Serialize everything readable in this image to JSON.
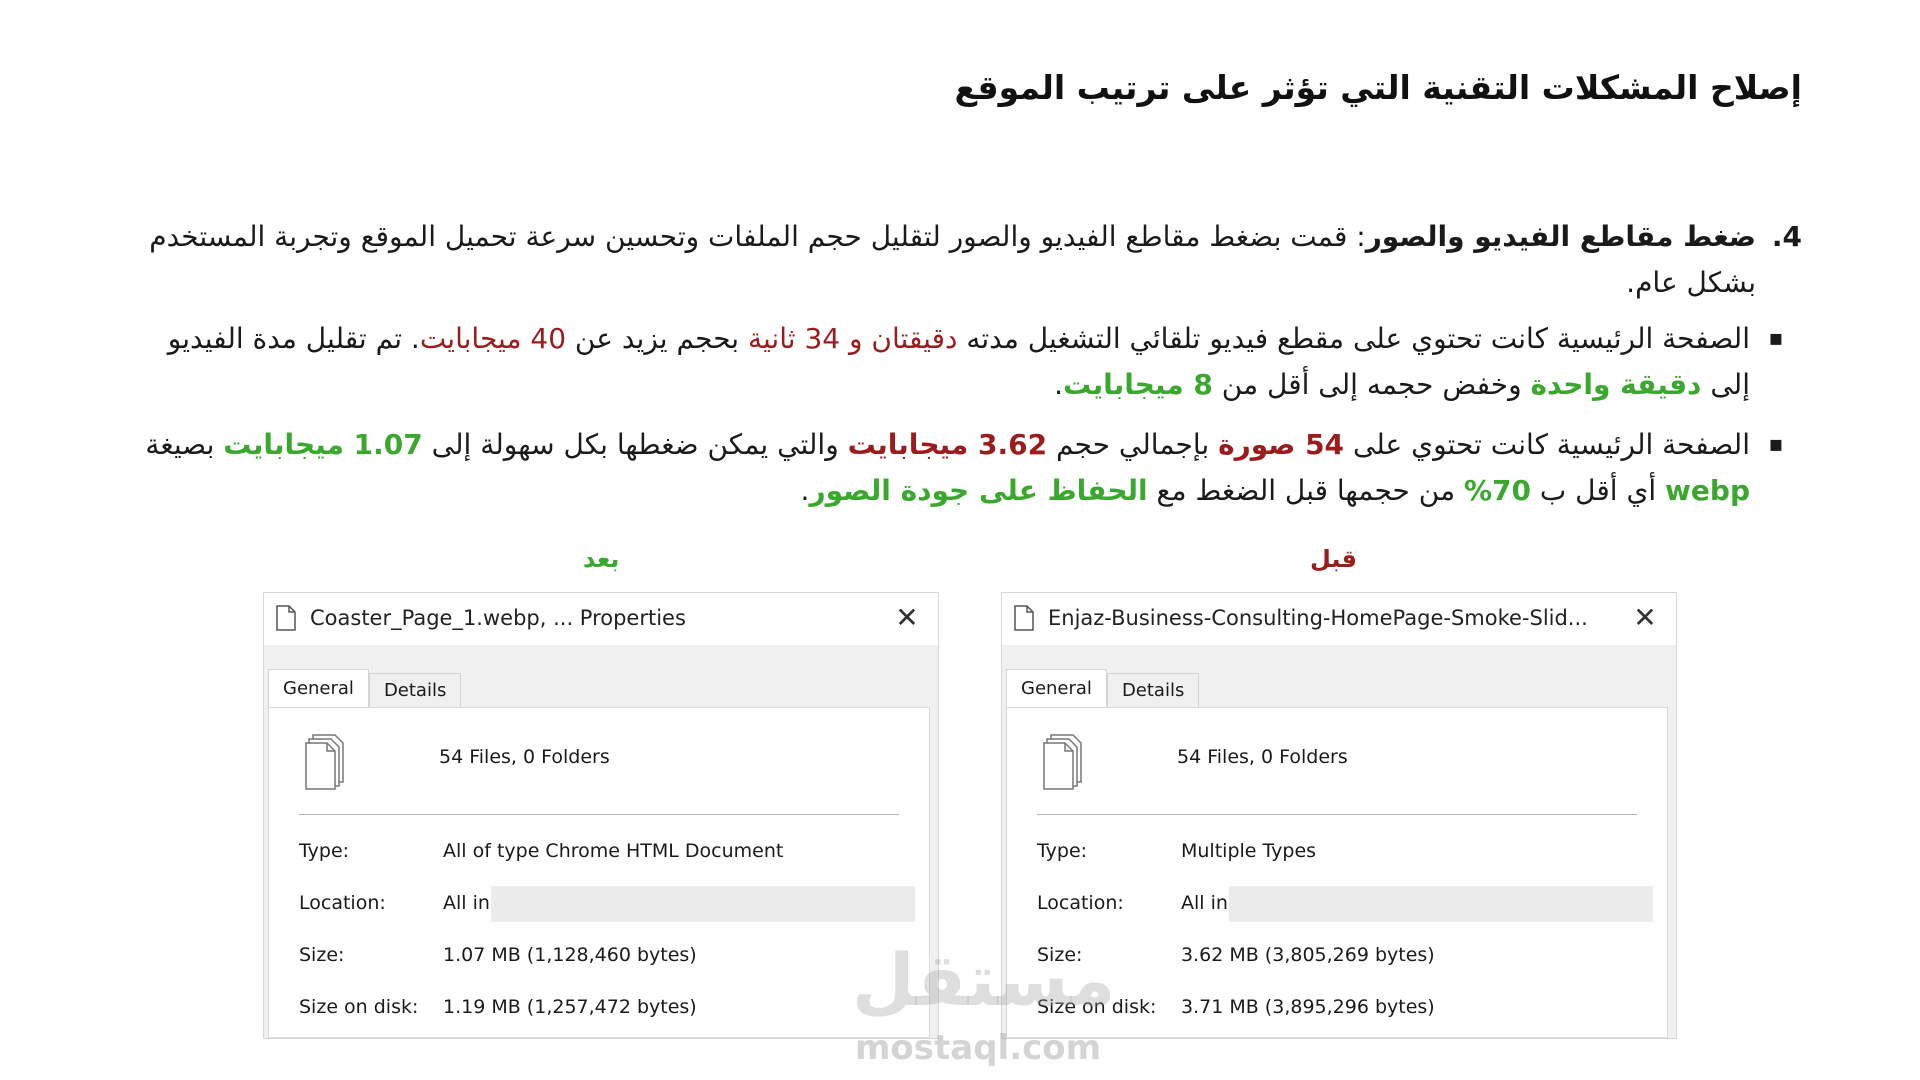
{
  "title": "إصلاح المشكلات التقنية التي تؤثر على ترتيب الموقع",
  "point": {
    "number": "4.",
    "heading": "ضغط مقاطع الفيديو والصور",
    "body": ": قمت بضغط مقاطع الفيديو والصور لتقليل حجم الملفات وتحسين سرعة تحميل الموقع وتجربة المستخدم بشكل عام."
  },
  "bullet1": {
    "t1": "الصفحة الرئيسية كانت تحتوي على مقطع فيديو تلقائي التشغيل مدته ",
    "duration_before": "دقيقتان و 34 ثانية",
    "t2": " بحجم يزيد عن ",
    "size_before": "40 ميجابايت",
    "t3": ". تم تقليل مدة الفيديو إلى ",
    "duration_after": "دقيقة واحدة",
    "t4": " وخفض حجمه إلى أقل من ",
    "size_after": "8 ميجابايت",
    "t5": "."
  },
  "bullet2": {
    "t1": "الصفحة الرئيسية كانت تحتوي على ",
    "images_count": "54 صورة",
    "t2": " بإجمالي حجم ",
    "total_size": "3.62 ميجابايت",
    "t3": " والتي يمكن ضغطها بكل سهولة إلى ",
    "compressed_size": "1.07 ميجابايت",
    "t4": " بصيغة ",
    "format": "webp",
    "t5": " أي أقل ب ",
    "percent": "70%",
    "t6": " من حجمها قبل الضغط مع ",
    "quality": "الحفاظ على جودة الصور",
    "t7": "."
  },
  "captions": {
    "after": "بعد",
    "before": "قبل"
  },
  "dialog_after": {
    "title": "Coaster_Page_1.webp, ... Properties",
    "tabs": [
      "General",
      "Details"
    ],
    "files": "54 Files, 0 Folders",
    "type_label": "Type:",
    "type_value": "All of type Chrome HTML Document",
    "location_label": "Location:",
    "location_value": "All in",
    "size_label": "Size:",
    "size_value": "1.07 MB (1,128,460 bytes)",
    "disk_label": "Size on disk:",
    "disk_value": "1.19 MB (1,257,472 bytes)"
  },
  "dialog_before": {
    "title": "Enjaz-Business-Consulting-HomePage-Smoke-Slid...",
    "tabs": [
      "General",
      "Details"
    ],
    "files": "54 Files, 0 Folders",
    "type_label": "Type:",
    "type_value": "Multiple Types",
    "location_label": "Location:",
    "location_value": "All in",
    "size_label": "Size:",
    "size_value": "3.62 MB (3,805,269 bytes)",
    "disk_label": "Size on disk:",
    "disk_value": "3.71 MB (3,895,296 bytes)"
  },
  "watermark": {
    "logo": "مستقل",
    "domain": "mostaql.com"
  },
  "colors": {
    "red": "#9b1c1c",
    "green": "#3aa82e",
    "text": "#111111"
  }
}
